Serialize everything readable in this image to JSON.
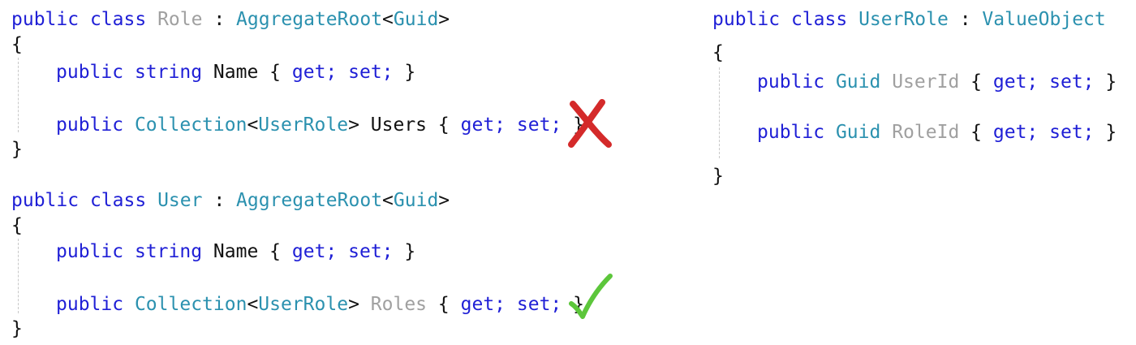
{
  "role_class": {
    "kw_public": "public",
    "kw_class": "class",
    "name": "Role",
    "colon": ":",
    "base": "AggregateRoot",
    "lt": "<",
    "generic": "Guid",
    "gt": ">",
    "open_brace": "{",
    "close_brace": "}",
    "prop_name": {
      "kw_public": "public",
      "type": "string",
      "name": "Name",
      "accessors_open": "{",
      "get": "get;",
      "set": "set;",
      "accessors_close": "}"
    },
    "prop_users": {
      "kw_public": "public",
      "type": "Collection",
      "lt": "<",
      "generic": "UserRole",
      "gt": ">",
      "name": "Users",
      "accessors_open": "{",
      "get": "get;",
      "set": "set;",
      "accessors_close": "}"
    },
    "verdict_icon": "red-x-icon",
    "verdict_color": "#d42a2a"
  },
  "user_class": {
    "kw_public": "public",
    "kw_class": "class",
    "name": "User",
    "colon": ":",
    "base": "AggregateRoot",
    "lt": "<",
    "generic": "Guid",
    "gt": ">",
    "open_brace": "{",
    "close_brace": "}",
    "prop_name": {
      "kw_public": "public",
      "type": "string",
      "name": "Name",
      "accessors_open": "{",
      "get": "get;",
      "set": "set;",
      "accessors_close": "}"
    },
    "prop_roles": {
      "kw_public": "public",
      "type": "Collection",
      "lt": "<",
      "generic": "UserRole",
      "gt": ">",
      "name": "Roles",
      "accessors_open": "{",
      "get": "get;",
      "set": "set;",
      "accessors_close": "}"
    },
    "verdict_icon": "green-checkmark-icon",
    "verdict_color": "#5cc63b"
  },
  "userrole_class": {
    "kw_public": "public",
    "kw_class": "class",
    "name": "UserRole",
    "colon": ":",
    "base": "ValueObject",
    "open_brace": "{",
    "close_brace": "}",
    "prop_userid": {
      "kw_public": "public",
      "type": "Guid",
      "name": "UserId",
      "accessors_open": "{",
      "get": "get;",
      "set": "set;",
      "accessors_close": "}"
    },
    "prop_roleid": {
      "kw_public": "public",
      "type": "Guid",
      "name": "RoleId",
      "accessors_open": "{",
      "get": "get;",
      "set": "set;",
      "accessors_close": "}"
    }
  },
  "colors": {
    "keyword": "#1f1fd6",
    "type": "#2b91af",
    "dimmed_identifier": "#a0a0a0",
    "plain": "#111111"
  }
}
